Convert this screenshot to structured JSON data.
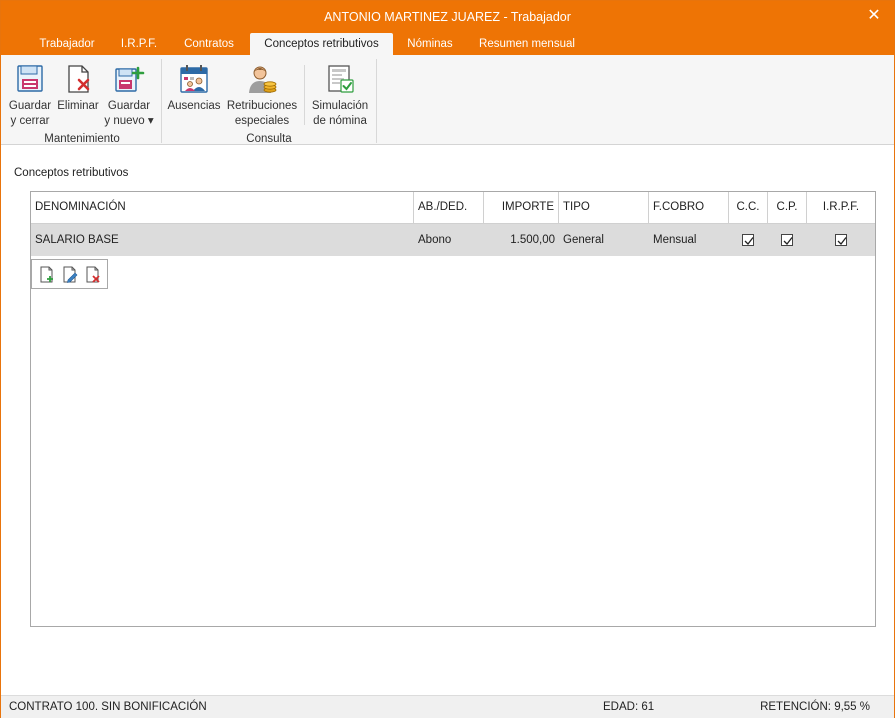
{
  "window": {
    "title": "ANTONIO MARTINEZ JUAREZ - Trabajador",
    "close_glyph": "✕"
  },
  "tabs": [
    {
      "label": "Trabajador"
    },
    {
      "label": "I.R.P.F."
    },
    {
      "label": "Contratos"
    },
    {
      "label": "Conceptos retributivos",
      "active": true
    },
    {
      "label": "Nóminas"
    },
    {
      "label": "Resumen mensual"
    }
  ],
  "ribbon": {
    "groups": {
      "mantenimiento": "Mantenimiento",
      "consulta": "Consulta"
    },
    "buttons": {
      "guardar_cerrar": {
        "line1": "Guardar",
        "line2": "y cerrar",
        "icon": "save-close-icon"
      },
      "eliminar": {
        "line1": "Eliminar",
        "line2": "",
        "icon": "delete-document-icon"
      },
      "guardar_nuevo": {
        "line1": "Guardar",
        "line2": "y nuevo ▾",
        "icon": "save-new-icon"
      },
      "ausencias": {
        "line1": "Ausencias",
        "line2": "",
        "icon": "calendar-people-icon"
      },
      "retribuciones": {
        "line1": "Retribuciones",
        "line2": "especiales",
        "icon": "person-coins-icon"
      },
      "simulacion": {
        "line1": "Simulación",
        "line2": "de nómina",
        "icon": "payslip-check-icon"
      }
    }
  },
  "section_label": "Conceptos retributivos",
  "table": {
    "headers": {
      "denominacion": "DENOMINACIÓN",
      "abded": "AB./DED.",
      "importe": "IMPORTE",
      "tipo": "TIPO",
      "fcobro": "F.COBRO",
      "cc": "C.C.",
      "cp": "C.P.",
      "irpf": "I.R.P.F."
    },
    "rows": [
      {
        "denominacion": "SALARIO BASE",
        "abded": "Abono",
        "importe": "1.500,00",
        "tipo": "General",
        "fcobro": "Mensual",
        "cc": true,
        "cp": true,
        "irpf": true
      }
    ],
    "row_tools": [
      "new-document-icon",
      "edit-document-icon",
      "delete-document-icon"
    ]
  },
  "status": {
    "contrato": "CONTRATO 100.  SIN BONIFICACIÓN",
    "edad": "EDAD: 61",
    "retencion": "RETENCIÓN: 9,55 %"
  },
  "colors": {
    "accent": "#ee7405",
    "ribbon_bg": "#f6f6f6",
    "selected_row": "#dcdcdc"
  }
}
